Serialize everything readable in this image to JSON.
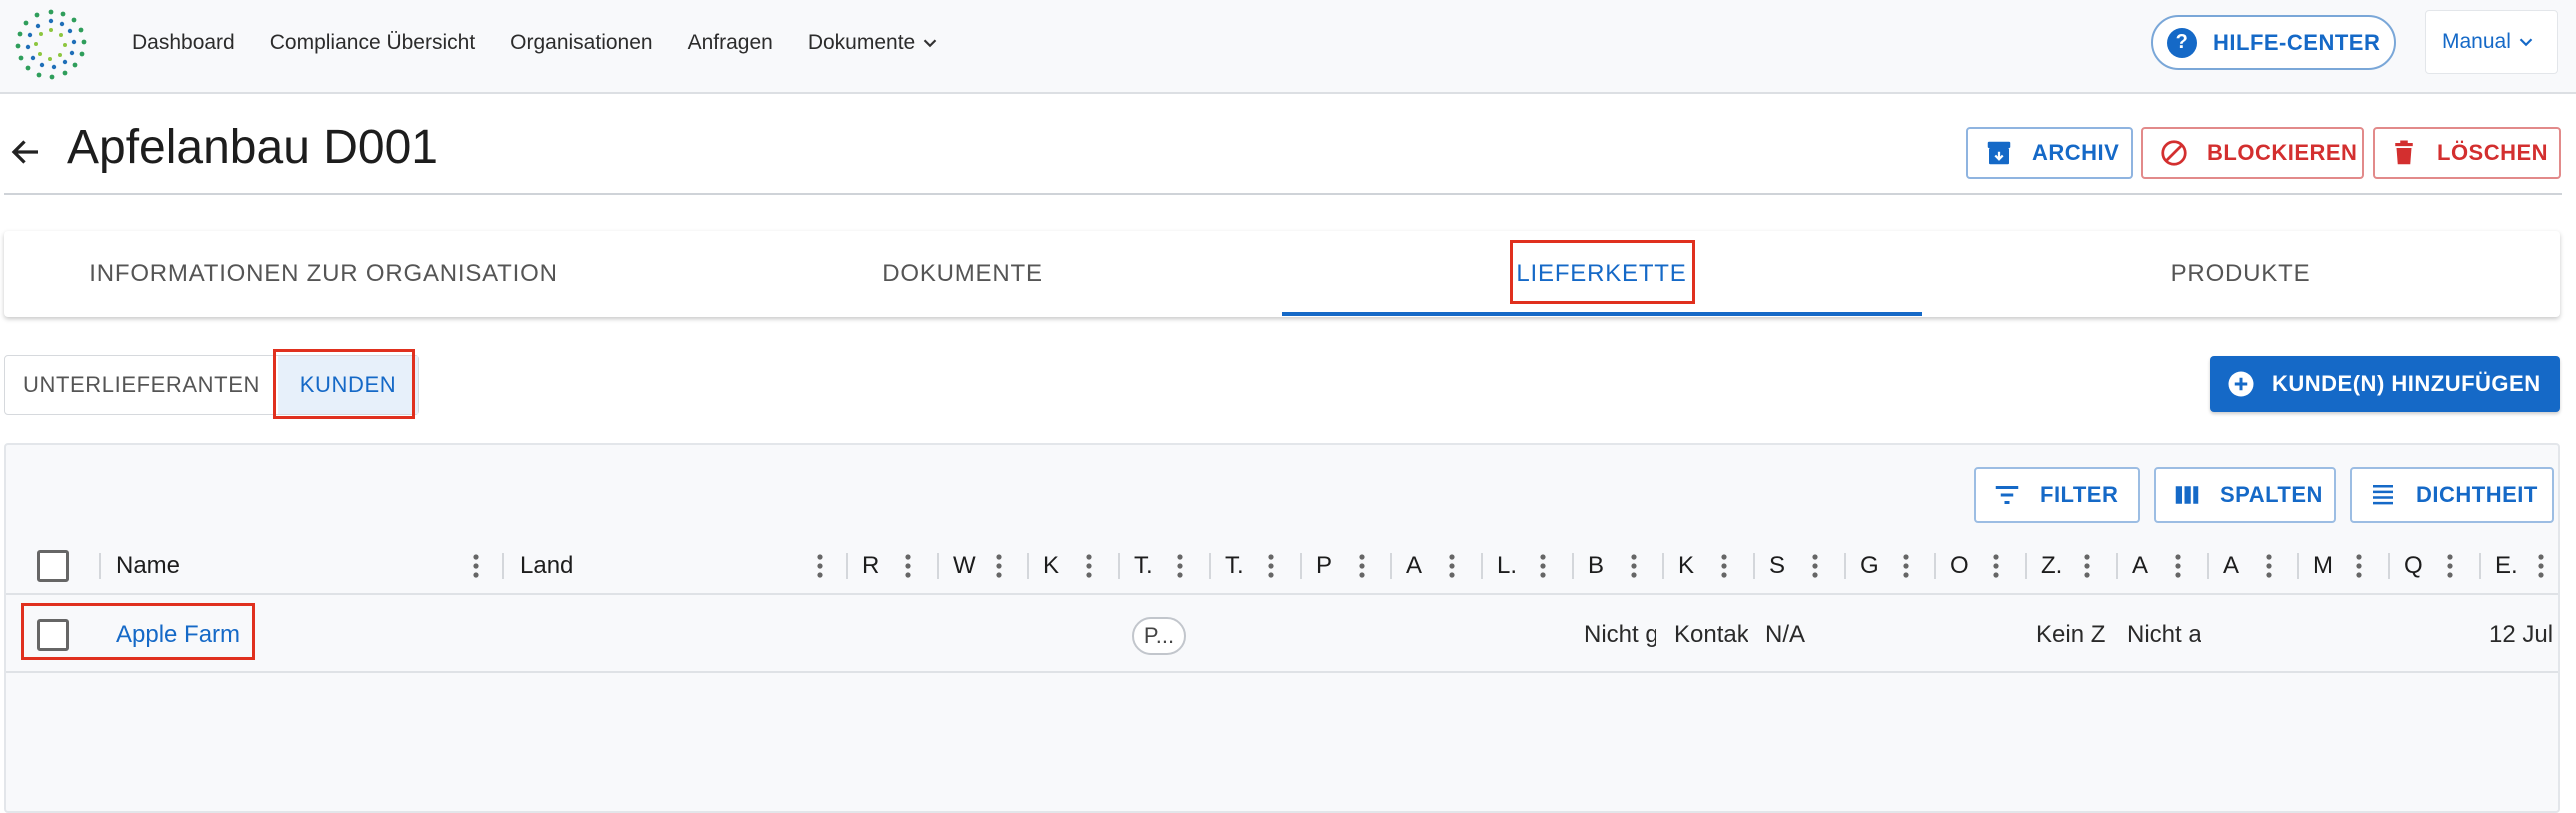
{
  "nav": {
    "links": [
      "Dashboard",
      "Compliance Übersicht",
      "Organisationen",
      "Anfragen",
      "Dokumente"
    ],
    "help_label": "HILFE-CENTER",
    "user_label": "Manual"
  },
  "page": {
    "title": "Apfelanbau D001",
    "archive_label": "ARCHIV",
    "block_label": "BLOCKIEREN",
    "delete_label": "LÖSCHEN"
  },
  "tabs": [
    {
      "label": "INFORMATIONEN ZUR ORGANISATION",
      "active": false
    },
    {
      "label": "DOKUMENTE",
      "active": false
    },
    {
      "label": "LIEFERKETTE",
      "active": true
    },
    {
      "label": "PRODUKTE",
      "active": false
    }
  ],
  "toggle": {
    "suppliers_label": "UNTERLIEFERANTEN",
    "customers_label": "KUNDEN",
    "selected": "KUNDEN"
  },
  "add_button_label": "KUNDE(N) HINZUFÜGEN",
  "toolbar": {
    "filter_label": "FILTER",
    "columns_label": "SPALTEN",
    "density_label": "DICHTHEIT"
  },
  "grid": {
    "columns": [
      "Name",
      "Land",
      "R",
      "W",
      "K",
      "T.",
      "T.",
      "P",
      "A",
      "L.",
      "B",
      "K",
      "S",
      "G",
      "O",
      "Z.",
      "A",
      "A",
      "M",
      "Q",
      "E."
    ],
    "rows": [
      {
        "name": "Apple Farm",
        "chip": "P...",
        "col_b": "Nicht g",
        "col_k": "Kontak",
        "col_s": "N/A",
        "col_z": "Kein Z",
        "col_a": "Nicht a",
        "col_e": "12 Jul"
      }
    ]
  },
  "colors": {
    "primary": "#1569c7",
    "danger": "#d32f2f",
    "highlight": "#e0301e"
  }
}
